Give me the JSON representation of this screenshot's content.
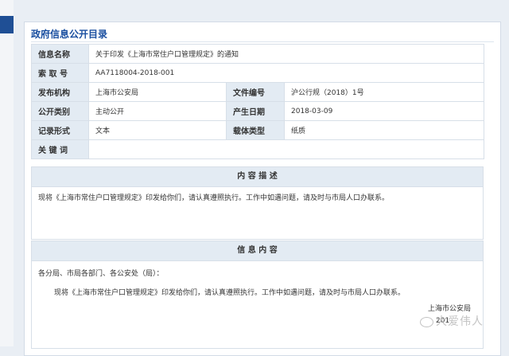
{
  "panel_title": "政府信息公开目录",
  "meta": {
    "info_name": {
      "label": "信息名称",
      "value": "关于印发《上海市常住户口管理规定》的通知"
    },
    "index_no": {
      "label": "索 取 号",
      "value": "AA7118004-2018-001"
    },
    "issuer": {
      "label": "发布机构",
      "value": "上海市公安局"
    },
    "doc_no": {
      "label": "文件编号",
      "value": "沪公行规（2018）1号"
    },
    "category": {
      "label": "公开类别",
      "value": "主动公开"
    },
    "date": {
      "label": "产生日期",
      "value": "2018-03-09"
    },
    "record_form": {
      "label": "记录形式",
      "value": "文本"
    },
    "carrier": {
      "label": "载体类型",
      "value": "纸质"
    },
    "keywords": {
      "label": "关 键 词",
      "value": ""
    }
  },
  "abstract": {
    "heading": "内 容 描 述",
    "text": "现将《上海市常住户口管理规定》印发给你们，请认真遵照执行。工作中如遇问题，请及时与市局人口办联系。"
  },
  "content": {
    "heading": "信 息 内 容",
    "salutation": "各分局、市局各部门、各公安处（局）：",
    "body": "现将《上海市常住户口管理规定》印发给你们，请认真遵照执行。工作中如遇问题，请及时与市局人口办联系。",
    "signature": "上海市公安局",
    "date_partial": "201"
  },
  "watermark": "大爱伟人",
  "colors": {
    "accent": "#1a4fa0",
    "tab": "#1f4f95",
    "label_bg": "#e3ebf3"
  }
}
